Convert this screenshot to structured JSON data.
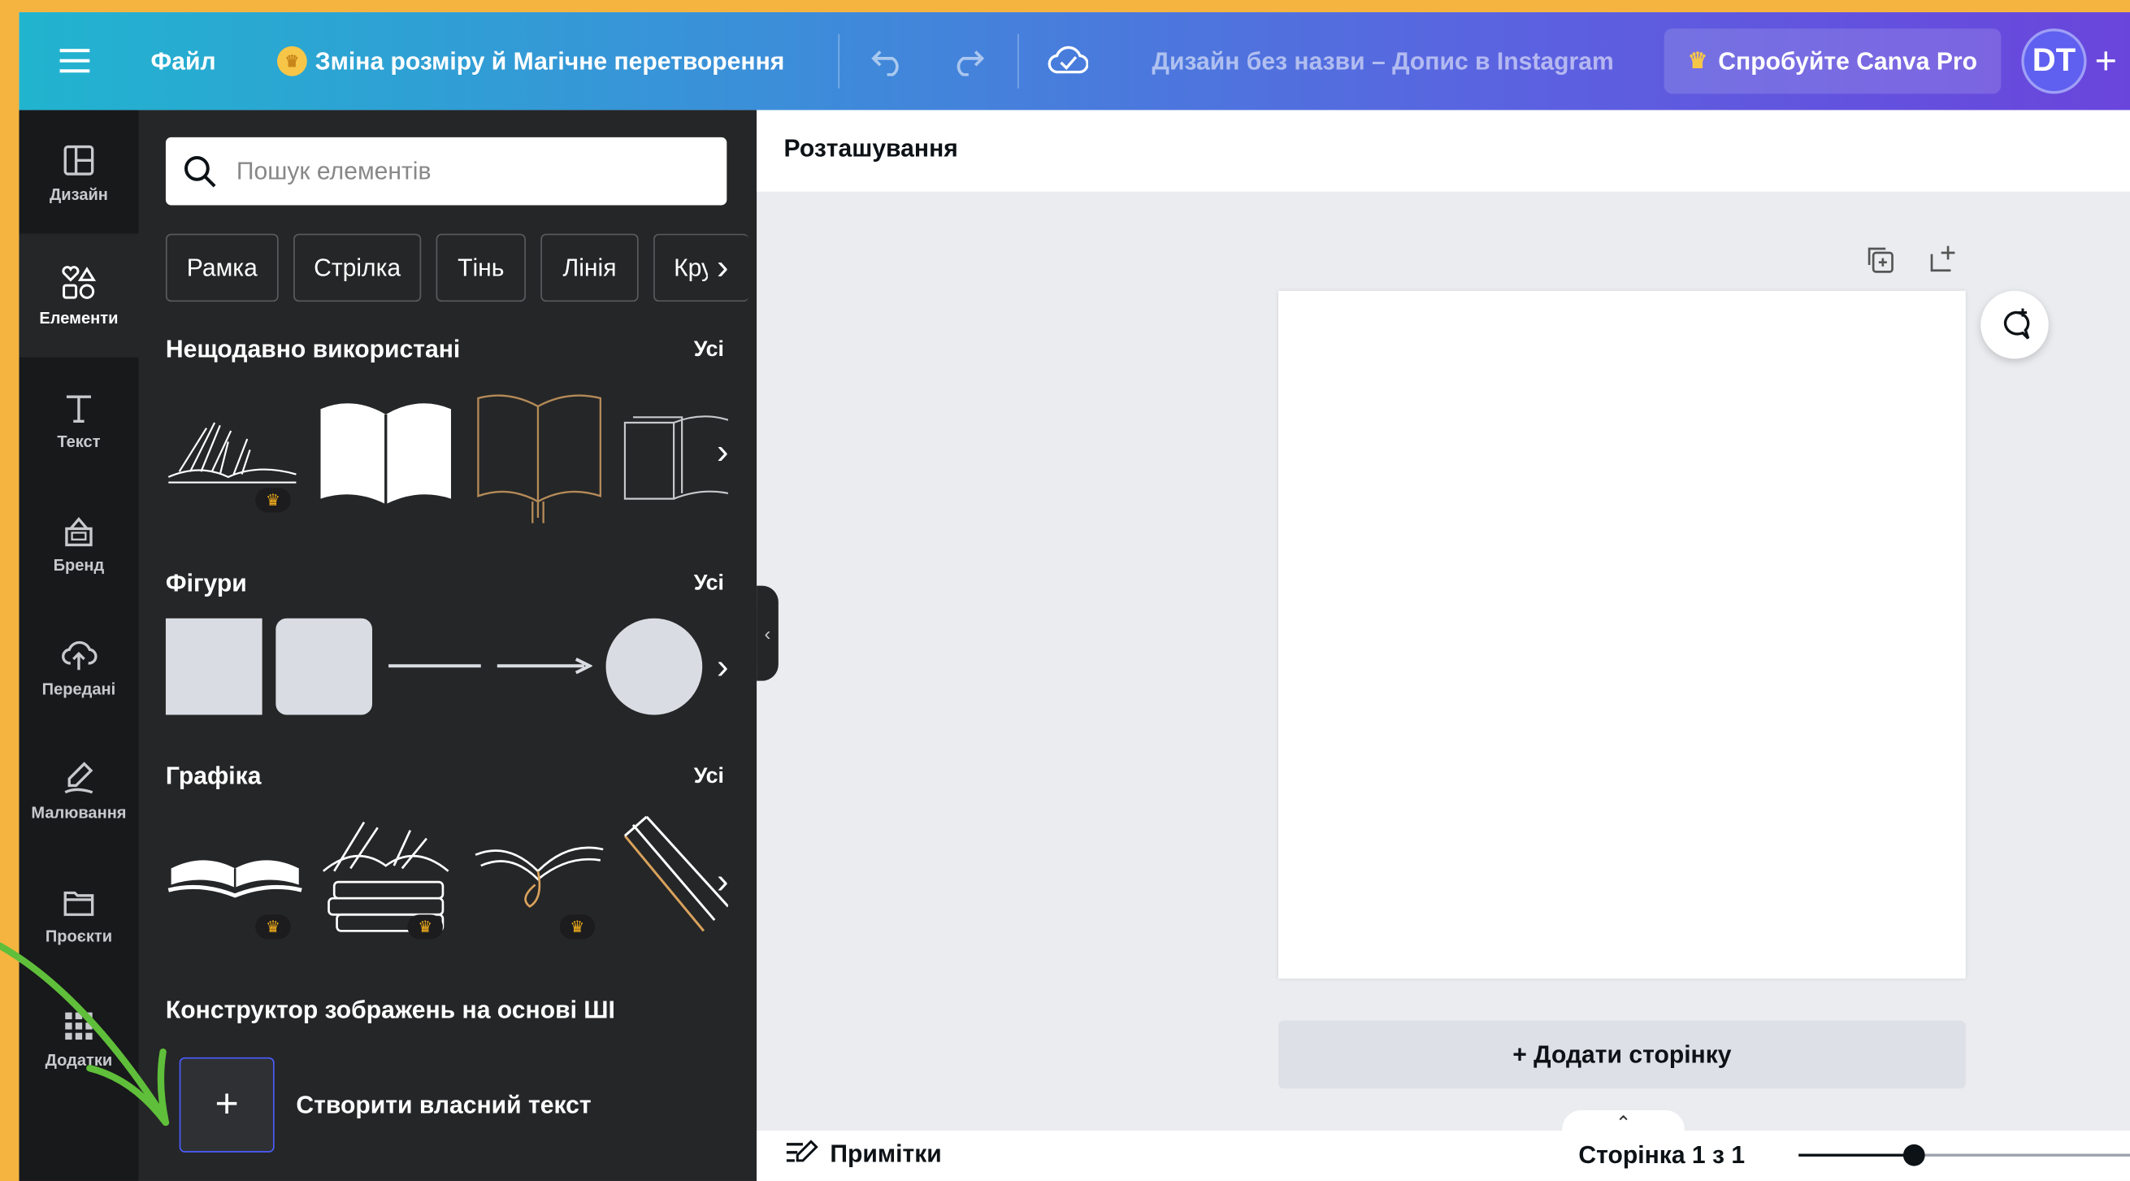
{
  "topbar": {
    "file_label": "Файл",
    "resize_label": "Зміна розміру й Магічне перетворення",
    "title": "Дизайн без назви – Допис в Instagram",
    "pro_label": "Спробуйте Canva Pro",
    "avatar_initials": "DT"
  },
  "nav": {
    "items": [
      {
        "label": "Дизайн",
        "icon": "layout-icon"
      },
      {
        "label": "Елементи",
        "icon": "shapes-icon",
        "active": true
      },
      {
        "label": "Текст",
        "icon": "text-icon"
      },
      {
        "label": "Бренд",
        "icon": "brand-icon"
      },
      {
        "label": "Передані",
        "icon": "upload-cloud-icon"
      },
      {
        "label": "Малювання",
        "icon": "draw-icon"
      },
      {
        "label": "Проєкти",
        "icon": "folder-icon"
      },
      {
        "label": "Додатки",
        "icon": "apps-grid-icon"
      }
    ]
  },
  "panel": {
    "search_placeholder": "Пошук елементів",
    "chips": [
      "Рамка",
      "Стрілка",
      "Тінь",
      "Лінія",
      "Кру"
    ],
    "recent_title": "Нещодавно використані",
    "shapes_title": "Фігури",
    "graphics_title": "Графіка",
    "all_label": "Усі",
    "ai_title": "Конструктор зображень на основі ШІ",
    "ai_create_label": "Створити власний текст"
  },
  "main": {
    "header_label": "Розташування",
    "add_page_label": "+ Додати сторінку",
    "notes_label": "Примітки",
    "page_indicator": "Сторінка 1 з 1",
    "zoom_fraction": 0.35
  },
  "colors": {
    "frame": "#f5b440",
    "panel_bg": "#252627",
    "nav_bg": "#18191b",
    "accent_arrow": "#5fbf3a",
    "crown": "#f5b01c"
  }
}
